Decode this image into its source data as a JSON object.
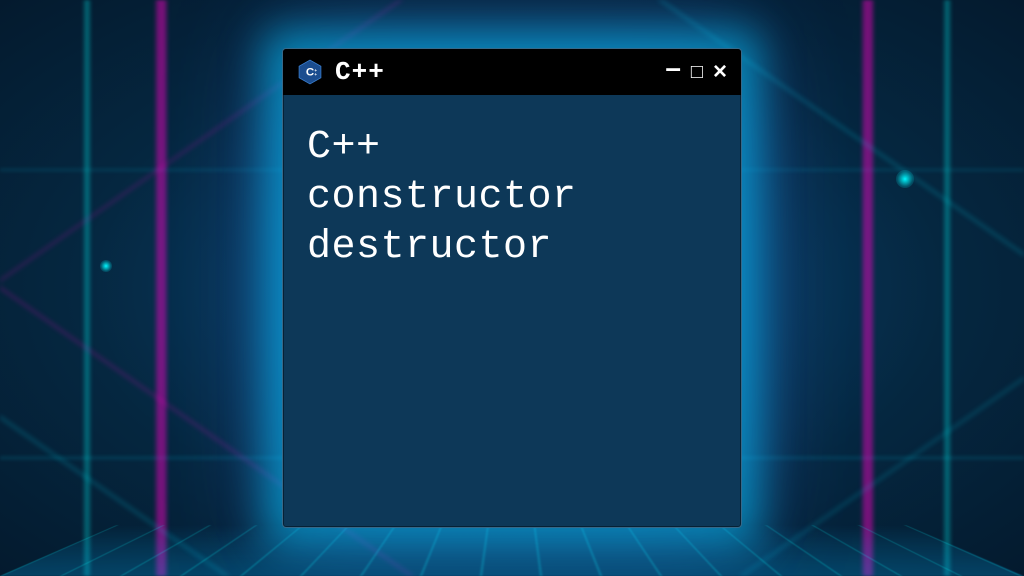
{
  "window": {
    "title": "C++",
    "icon_name": "cpp-logo",
    "controls": {
      "minimize": "–",
      "maximize": "□",
      "close": "×"
    }
  },
  "content": {
    "lines": [
      "C++",
      "constructor",
      "destructor"
    ]
  },
  "colors": {
    "window_bg": "#0d3858",
    "titlebar_bg": "#000000",
    "text": "#ffffff",
    "glow": "#00c8ff"
  }
}
